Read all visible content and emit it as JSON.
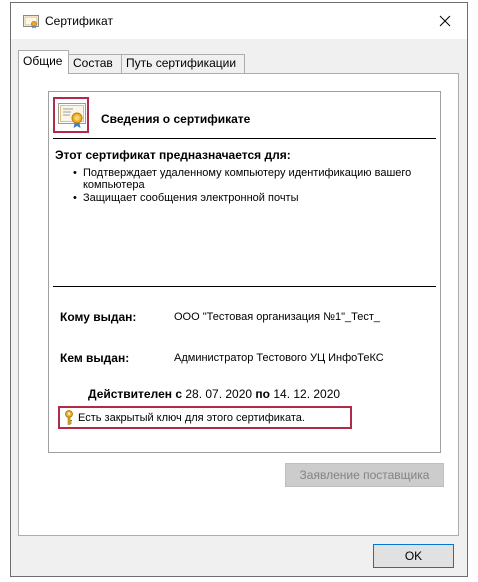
{
  "window": {
    "title": "Сертификат"
  },
  "tabs": [
    {
      "label": "Общие",
      "active": true
    },
    {
      "label": "Состав",
      "active": false
    },
    {
      "label": "Путь сертификации",
      "active": false
    }
  ],
  "general": {
    "heading": "Сведения о сертификате",
    "purpose_title": "Этот сертификат предназначается для:",
    "purposes": [
      "Подтверждает удаленному компьютеру идентификацию вашего компьютера",
      "Защищает сообщения электронной почты"
    ],
    "issued_to_label": "Кому выдан:",
    "issued_to_value": "ООО \"Тестовая организация №1\"_Тест_",
    "issued_by_label": "Кем выдан:",
    "issued_by_value": "Администратор Тестового УЦ ИнфоТеКС",
    "valid_from_label": "Действителен с",
    "valid_from": "28. 07. 2020",
    "valid_to_label": "по",
    "valid_to": "14. 12. 2020",
    "private_key_note": "Есть закрытый ключ для этого сертификата."
  },
  "buttons": {
    "issuer_statement": "Заявление поставщика",
    "ok": "OK"
  },
  "colors": {
    "highlight": "#b22a4a",
    "ok_border": "#0078d7",
    "disabled_text": "#838383"
  },
  "icons": {
    "title": "certificate-icon",
    "close": "close-icon",
    "cert": "certificate-icon",
    "key": "key-icon"
  }
}
